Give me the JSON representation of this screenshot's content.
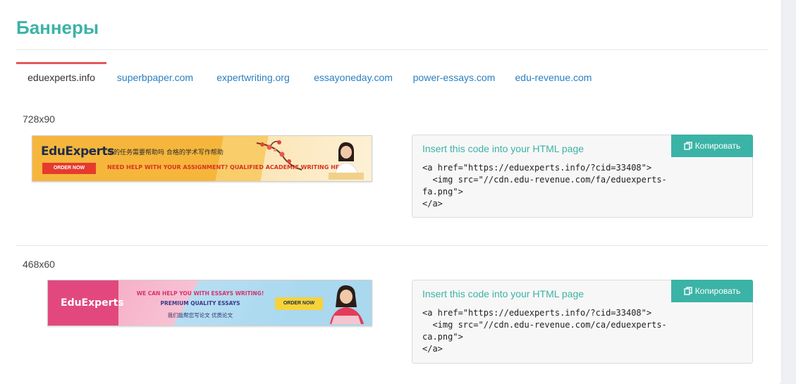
{
  "page": {
    "title": "Баннеры"
  },
  "tabs": [
    {
      "label": "eduexperts.info",
      "active": true
    },
    {
      "label": "superbpaper.com",
      "active": false
    },
    {
      "label": "expertwriting.org",
      "active": false
    },
    {
      "label": "essayoneday.com",
      "active": false
    },
    {
      "label": "power-essays.com",
      "active": false
    },
    {
      "label": "edu-revenue.com",
      "active": false
    }
  ],
  "sections": [
    {
      "size": "728x90",
      "banner": {
        "logo": "EduExperts",
        "cn_text": "您的任务需要帮助吗 合格的学术写作帮助",
        "en_text": "NEED HELP WITH YOUR ASSIGNMENT?  QUALIFIED ACADEMIC WRITING HELP!",
        "order_label": "ORDER NOW"
      },
      "code": {
        "title": "Insert this code into your HTML page",
        "copy_label": "Копировать",
        "snippet": "<a href=\"https://eduexperts.info/?cid=33408\">\n  <img src=\"//cdn.edu-revenue.com/fa/eduexperts-\nfa.png\">\n</a>"
      }
    },
    {
      "size": "468x60",
      "banner": {
        "logo": "EduExperts",
        "line1": "WE CAN HELP YOU WITH ESSAYS WRITING!",
        "line2": "PREMIUM QUALITY ESSAYS",
        "cn_text": "我们能帮您写论文   优质论文",
        "order_label": "ORDER NOW"
      },
      "code": {
        "title": "Insert this code into your HTML page",
        "copy_label": "Копировать",
        "snippet": "<a href=\"https://eduexperts.info/?cid=33408\">\n  <img src=\"//cdn.edu-revenue.com/ca/eduexperts-\nca.png\">\n</a>"
      }
    }
  ],
  "colors": {
    "accent": "#3bb3a6",
    "tab_link": "#2b7fc0",
    "tab_active_bar": "#e35a5a"
  },
  "icons": {
    "copy": "copy-icon"
  }
}
